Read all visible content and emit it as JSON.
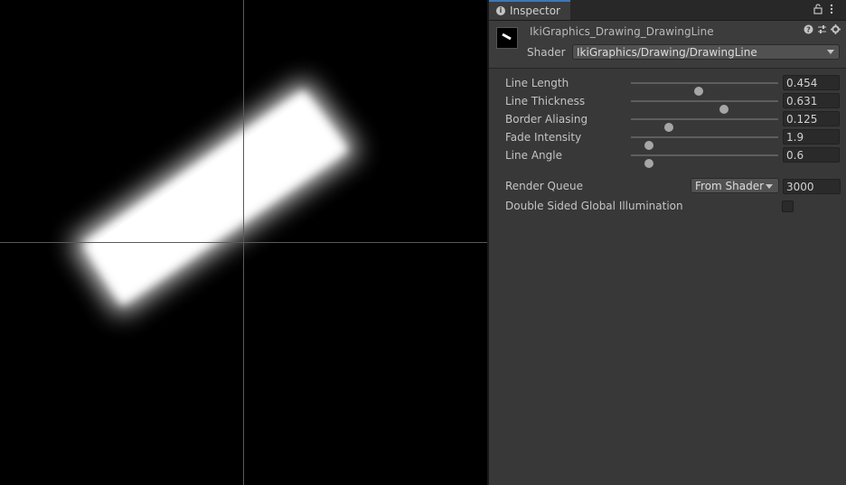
{
  "scene": {
    "guide_color": "#5a5a5a",
    "line_color": "#ffffff"
  },
  "inspector": {
    "tab_label": "Inspector",
    "tab_icon": "info-icon",
    "toolbar_icons": [
      "lock-icon",
      "kebab-menu-icon"
    ],
    "material_name": "IkiGraphics_Drawing_DrawingLine",
    "header_icons": [
      "help-icon",
      "preset-icon",
      "gear-icon"
    ],
    "shader_label": "Shader",
    "shader_value": "IkiGraphics/Drawing/DrawingLine",
    "properties": [
      {
        "label": "Line Length",
        "value": "0.454",
        "fraction": 0.46
      },
      {
        "label": "Line Thickness",
        "value": "0.631",
        "fraction": 0.63
      },
      {
        "label": "Border Aliasing",
        "value": "0.125",
        "fraction": 0.26
      },
      {
        "label": "Fade Intensity",
        "value": "1.9",
        "fraction": 0.12
      },
      {
        "label": "Line Angle",
        "value": "0.6",
        "fraction": 0.12
      }
    ],
    "render_queue": {
      "label": "Render Queue",
      "dropdown": "From Shader",
      "value": "3000"
    },
    "double_sided_gi": {
      "label": "Double Sided Global Illumination",
      "checked": false
    },
    "accent_color": "#3a79bb"
  }
}
